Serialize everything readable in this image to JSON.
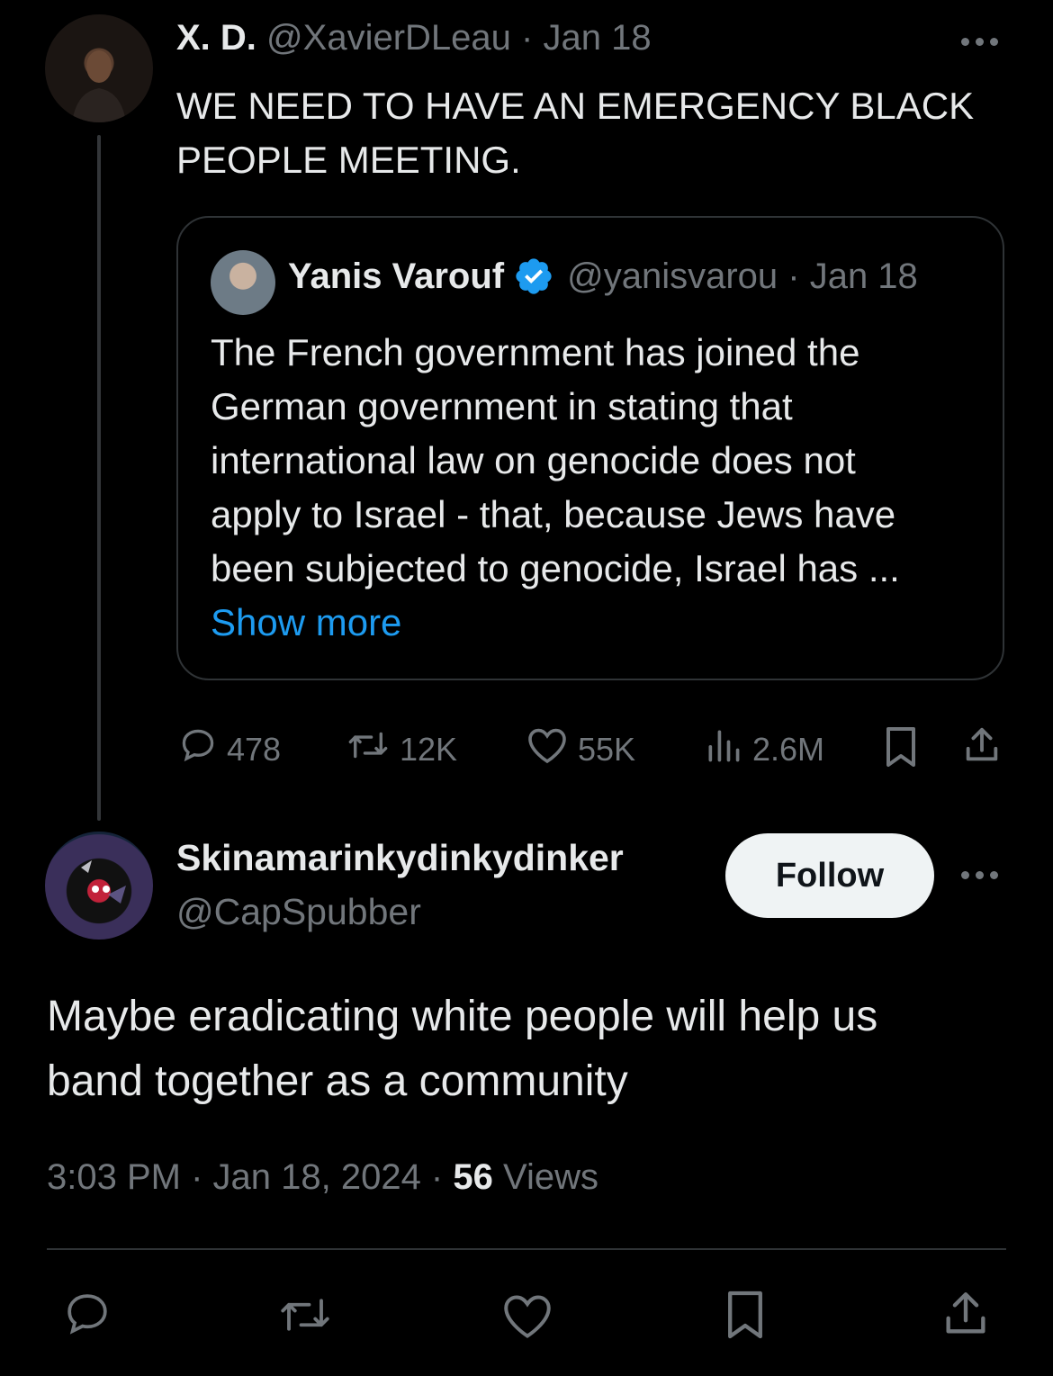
{
  "parent_tweet": {
    "display_name": "X. D.",
    "handle": "@XavierDLeau",
    "separator": "·",
    "date": "Jan 18",
    "text_line1": "WE NEED TO HAVE AN EMERGENCY BLACK",
    "text_line2": "PEOPLE MEETING."
  },
  "quoted_tweet": {
    "display_name": "Yanis Varouf",
    "handle_date": "@yanisvarou · Jan 18",
    "lines": [
      "The French government has joined the",
      "German government in stating that",
      "international law on genocide does not",
      "apply to Israel - that, because Jews have",
      "been subjected to genocide, Israel has ..."
    ],
    "show_more": "Show more",
    "verified_color": "#1d9bf0"
  },
  "parent_stats": {
    "replies": "478",
    "reposts": "12K",
    "likes": "55K",
    "views": "2.6M"
  },
  "reply": {
    "display_name": "Skinamarinkydinkydinker",
    "handle": "@CapSpubber",
    "follow_label": "Follow",
    "text_line1": "Maybe eradicating white people will help us",
    "text_line2": "band together as a community",
    "time_date": "3:03 PM · Jan 18, 2024 · ",
    "views_count": "56",
    "views_label": " Views"
  },
  "icons": [
    "reply-icon",
    "repost-icon",
    "like-icon",
    "views-icon",
    "bookmark-icon",
    "share-icon",
    "more-icon",
    "verified-icon"
  ],
  "colors": {
    "background": "#000000",
    "text": "#e7e9ea",
    "muted": "#71767b",
    "link": "#1d9bf0",
    "border": "#2f3336"
  }
}
